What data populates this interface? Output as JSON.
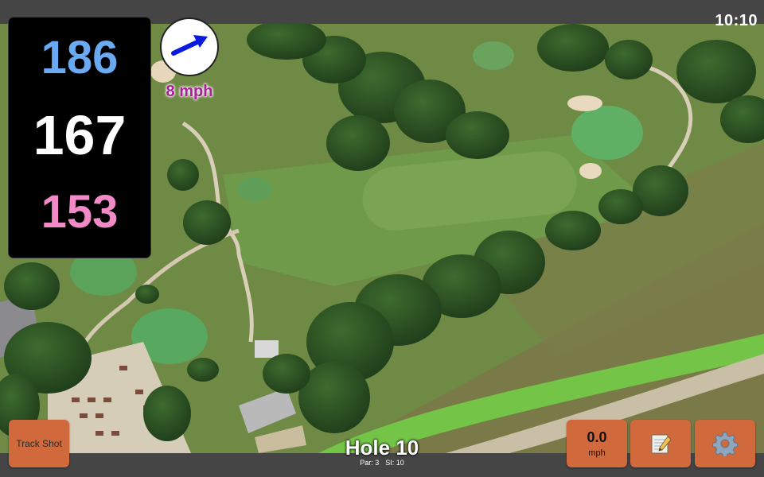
{
  "status": {
    "time": "10:10"
  },
  "distances": {
    "back": "186",
    "center": "167",
    "front": "153",
    "colors": {
      "back": "#6aaaf2",
      "center": "#ffffff",
      "front": "#f28ac8"
    }
  },
  "wind": {
    "speed_label": "8 mph",
    "icon": "wind-direction-arrow",
    "arrow_color": "#0a1ae0",
    "label_color": "#a81f98"
  },
  "hole": {
    "title": "Hole 10",
    "par": "Par: 3",
    "stroke_index": "SI: 10"
  },
  "buttons": {
    "track_shot": "Track Shot",
    "speed_value": "0.0",
    "speed_unit": "mph",
    "notes_icon": "notepad-pencil-icon",
    "settings_icon": "gear-icon",
    "accent": "#d06a3c"
  }
}
